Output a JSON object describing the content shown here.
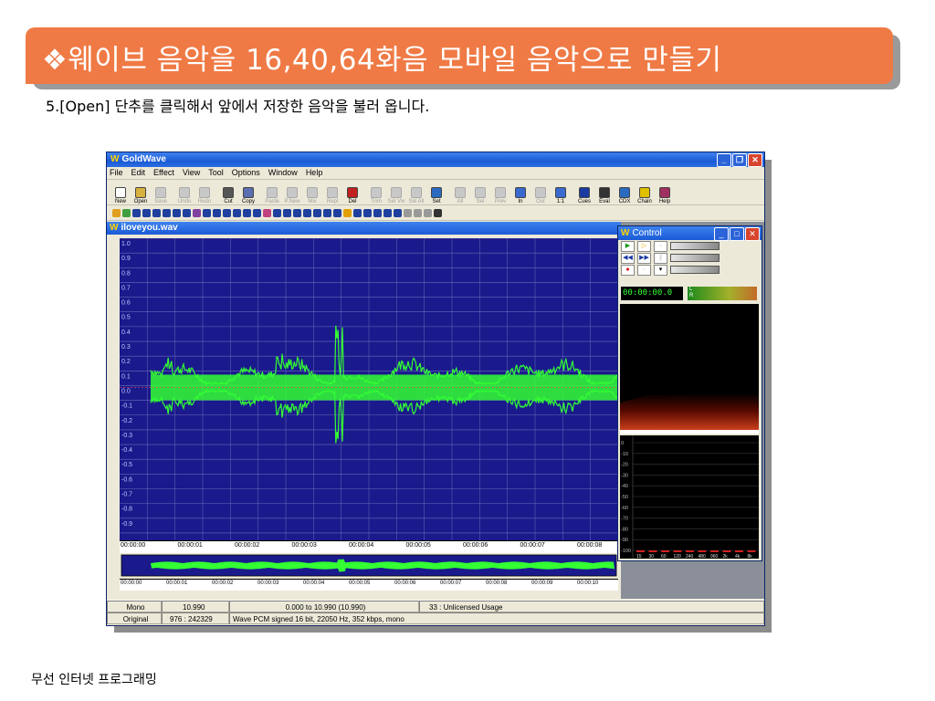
{
  "slide": {
    "title": "❖웨이브 음악을 16,40,64화음 모바일 음악으로 만들기",
    "subtitle": "5.[Open] 단추를 클릭해서 앞에서 저장한 음악을 불러 옵니다.",
    "footer": "무선 인터넷 프로그래밍",
    "accent_color": "#ef7a45"
  },
  "app": {
    "title": "GoldWave",
    "menu": [
      "File",
      "Edit",
      "Effect",
      "View",
      "Tool",
      "Options",
      "Window",
      "Help"
    ],
    "toolbar": [
      {
        "label": "New",
        "icon": "new-file-icon",
        "enabled": true
      },
      {
        "label": "Open",
        "icon": "open-folder-icon",
        "enabled": true
      },
      {
        "label": "Save",
        "icon": "save-disk-icon",
        "enabled": false
      },
      {
        "label": "Undo",
        "icon": "undo-icon",
        "enabled": false
      },
      {
        "label": "Redo",
        "icon": "redo-icon",
        "enabled": false
      },
      {
        "label": "Cut",
        "icon": "scissors-icon",
        "enabled": true
      },
      {
        "label": "Copy",
        "icon": "copy-icon",
        "enabled": true
      },
      {
        "label": "Paste",
        "icon": "paste-icon",
        "enabled": false
      },
      {
        "label": "P.New",
        "icon": "paste-new-icon",
        "enabled": false
      },
      {
        "label": "Mix",
        "icon": "mix-icon",
        "enabled": false
      },
      {
        "label": "Repl",
        "icon": "replace-icon",
        "enabled": false
      },
      {
        "label": "Del",
        "icon": "delete-icon",
        "enabled": true
      },
      {
        "label": "Trim",
        "icon": "trim-icon",
        "enabled": false
      },
      {
        "label": "Sel Vw",
        "icon": "select-view-icon",
        "enabled": false
      },
      {
        "label": "Sel All",
        "icon": "select-all-icon",
        "enabled": false
      },
      {
        "label": "Set",
        "icon": "set-marker-icon",
        "enabled": true
      },
      {
        "label": "All",
        "icon": "zoom-all-icon",
        "enabled": false
      },
      {
        "label": "Sel",
        "icon": "zoom-sel-icon",
        "enabled": false
      },
      {
        "label": "Prev",
        "icon": "zoom-prev-icon",
        "enabled": false
      },
      {
        "label": "In",
        "icon": "zoom-in-icon",
        "enabled": true
      },
      {
        "label": "Out",
        "icon": "zoom-out-icon",
        "enabled": false
      },
      {
        "label": "1:1",
        "icon": "zoom-1to1-icon",
        "enabled": true
      },
      {
        "label": "Cues",
        "icon": "cues-icon",
        "enabled": true
      },
      {
        "label": "Eval",
        "icon": "eval-icon",
        "enabled": true
      },
      {
        "label": "CDX",
        "icon": "cdx-icon",
        "enabled": true
      },
      {
        "label": "Chain",
        "icon": "chain-icon",
        "enabled": true
      },
      {
        "label": "Help",
        "icon": "help-book-icon",
        "enabled": true
      }
    ],
    "document": {
      "title": "iloveyou.wav",
      "amplitude_ticks": [
        "1.0",
        "0.9",
        "0.8",
        "0.7",
        "0.6",
        "0.5",
        "0.4",
        "0.3",
        "0.2",
        "0.1",
        "0.0",
        "-0.1",
        "-0.2",
        "-0.3",
        "-0.4",
        "-0.5",
        "-0.6",
        "-0.7",
        "-0.8",
        "-0.9"
      ],
      "time_ticks": [
        "00:00:00",
        "00:00:01",
        "00:00:02",
        "00:00:03",
        "00:00:04",
        "00:00:05",
        "00:00:06",
        "00:00:07",
        "00:00:08"
      ],
      "overview_ticks": [
        "00:00:00",
        "00:00:01",
        "00:00:02",
        "00:00:03",
        "00:00:04",
        "00:00:05",
        "00:00:06",
        "00:00:07",
        "00:00:08",
        "00:00:09",
        "00:00:10"
      ],
      "wave_bg": "#1a1a8c",
      "wave_color": "#33ff33"
    },
    "control": {
      "title": "Control",
      "time": "00:00:00.0",
      "level_labels": [
        "L",
        "R"
      ],
      "db_ticks": [
        "0",
        "-10",
        "-20",
        "-30",
        "-40",
        "-50",
        "-60",
        "-70",
        "-80",
        "-90",
        "-100"
      ],
      "freq_ticks": [
        "15",
        "30",
        "60",
        "120",
        "240",
        "480",
        "960",
        "2k",
        "4k",
        "8k"
      ]
    },
    "status": {
      "channels": "Mono",
      "duration": "10.990",
      "selection": "0.000 to 10.990 (10.990)",
      "usage": "33 : Unlicensed Usage",
      "mode": "Original",
      "ratio": "976 : 242329",
      "format": "Wave PCM signed 16 bit, 22050 Hz, 352 kbps, mono"
    }
  }
}
